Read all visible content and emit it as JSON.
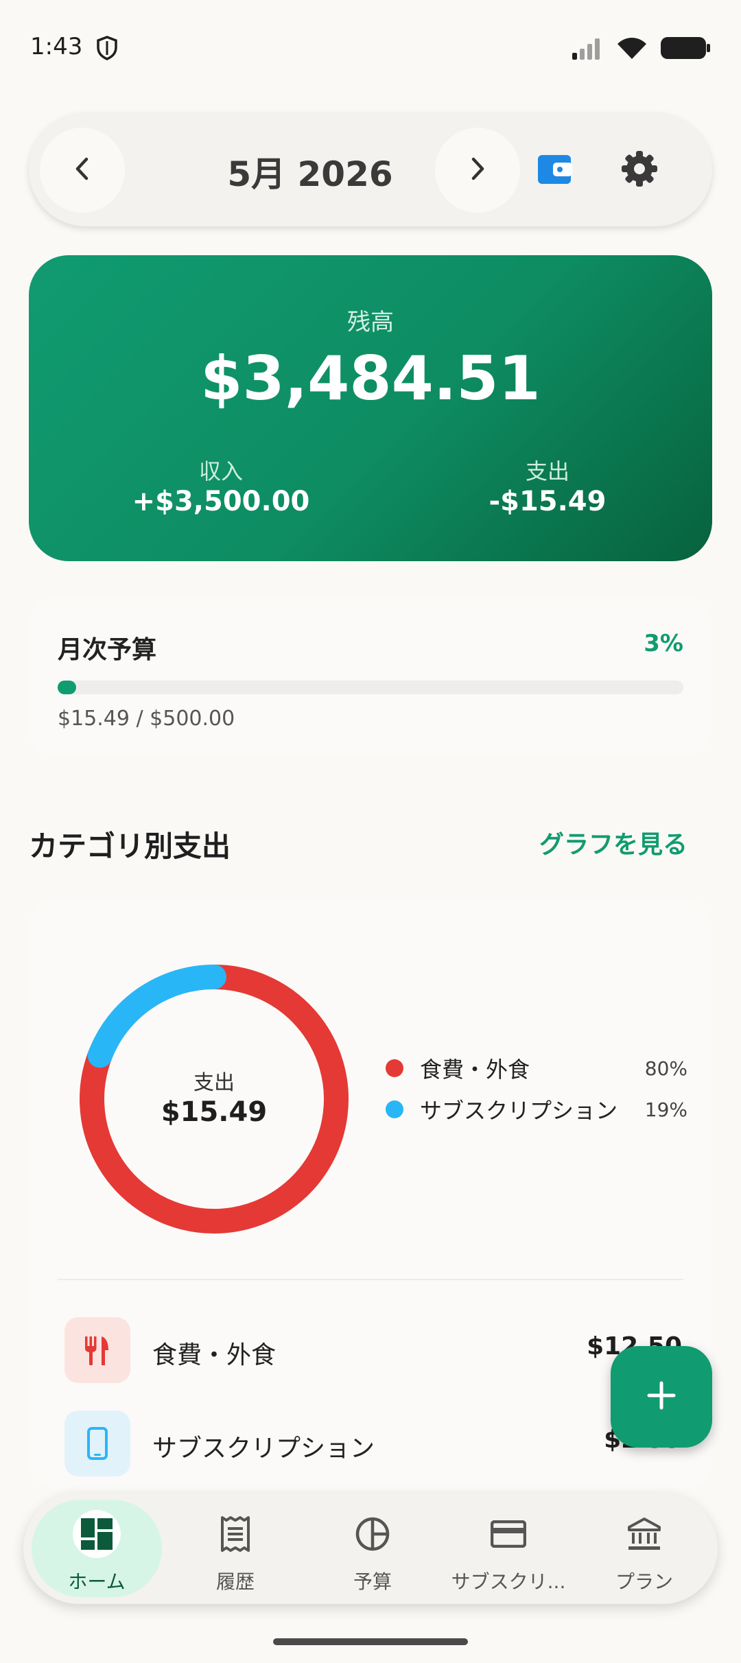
{
  "status_bar": {
    "time": "1:43"
  },
  "header": {
    "month_label": "5月 2026"
  },
  "balance": {
    "label": "残高",
    "value": "$3,484.51",
    "income_label": "収入",
    "income_value": "+$3,500.00",
    "expense_label": "支出",
    "expense_value": "-$15.49"
  },
  "budget": {
    "title": "月次予算",
    "percent_label": "3%",
    "progress": 0.03,
    "amount": "$15.49 / $500.00"
  },
  "category_section": {
    "title": "カテゴリ別支出",
    "link": "グラフを見る"
  },
  "chart_data": {
    "type": "pie",
    "center_label": "支出",
    "center_value": "$15.49",
    "slices": [
      {
        "name": "食費・外食",
        "percent_label": "80%",
        "value": 80,
        "color": "#E53935"
      },
      {
        "name": "サブスクリプション",
        "percent_label": "19%",
        "value": 19,
        "color": "#29B6F6"
      }
    ]
  },
  "categories": [
    {
      "name": "食費・外食",
      "amount": "$12.50",
      "icon": "fork-knife-icon",
      "icon_color": "#E53935",
      "icon_bg": "#FBE3DF"
    },
    {
      "name": "サブスクリプション",
      "amount": "$2.99",
      "icon": "smartphone-icon",
      "icon_color": "#29B6F6",
      "icon_bg": "#E1F2FA"
    }
  ],
  "nav": {
    "items": [
      {
        "label": "ホーム",
        "icon": "dashboard-icon",
        "active": true
      },
      {
        "label": "履歴",
        "icon": "receipt-icon",
        "active": false
      },
      {
        "label": "予算",
        "icon": "pie-chart-icon",
        "active": false
      },
      {
        "label": "サブスクリ...",
        "icon": "credit-card-icon",
        "active": false
      },
      {
        "label": "プラン",
        "icon": "bank-icon",
        "active": false
      }
    ]
  },
  "colors": {
    "accent": "#119B70",
    "background": "#FAF9F6"
  }
}
